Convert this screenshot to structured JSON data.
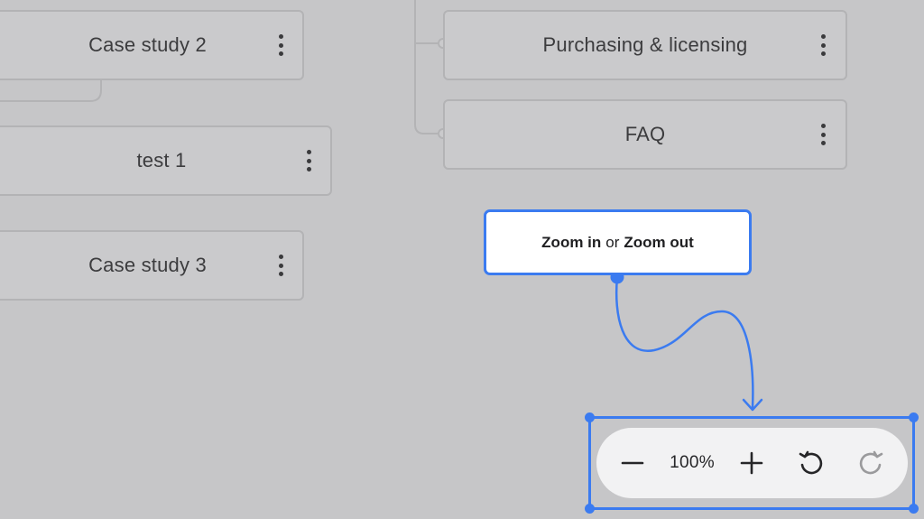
{
  "nodes": {
    "case_study_2": "Case study 2",
    "test_1": "test 1",
    "case_study_3": "Case study 3",
    "purchasing": "Purchasing & licensing",
    "faq": "FAQ"
  },
  "callout": {
    "zoom_in": "Zoom in",
    "or": "or",
    "zoom_out": "Zoom out"
  },
  "zoom_toolbar": {
    "level": "100%",
    "icons": [
      "minus-icon",
      "plus-icon",
      "undo-icon",
      "redo-icon"
    ]
  },
  "colors": {
    "background": "#c6c6c8",
    "accent": "#3b7bf0",
    "toolbar": "#f2f2f3"
  }
}
